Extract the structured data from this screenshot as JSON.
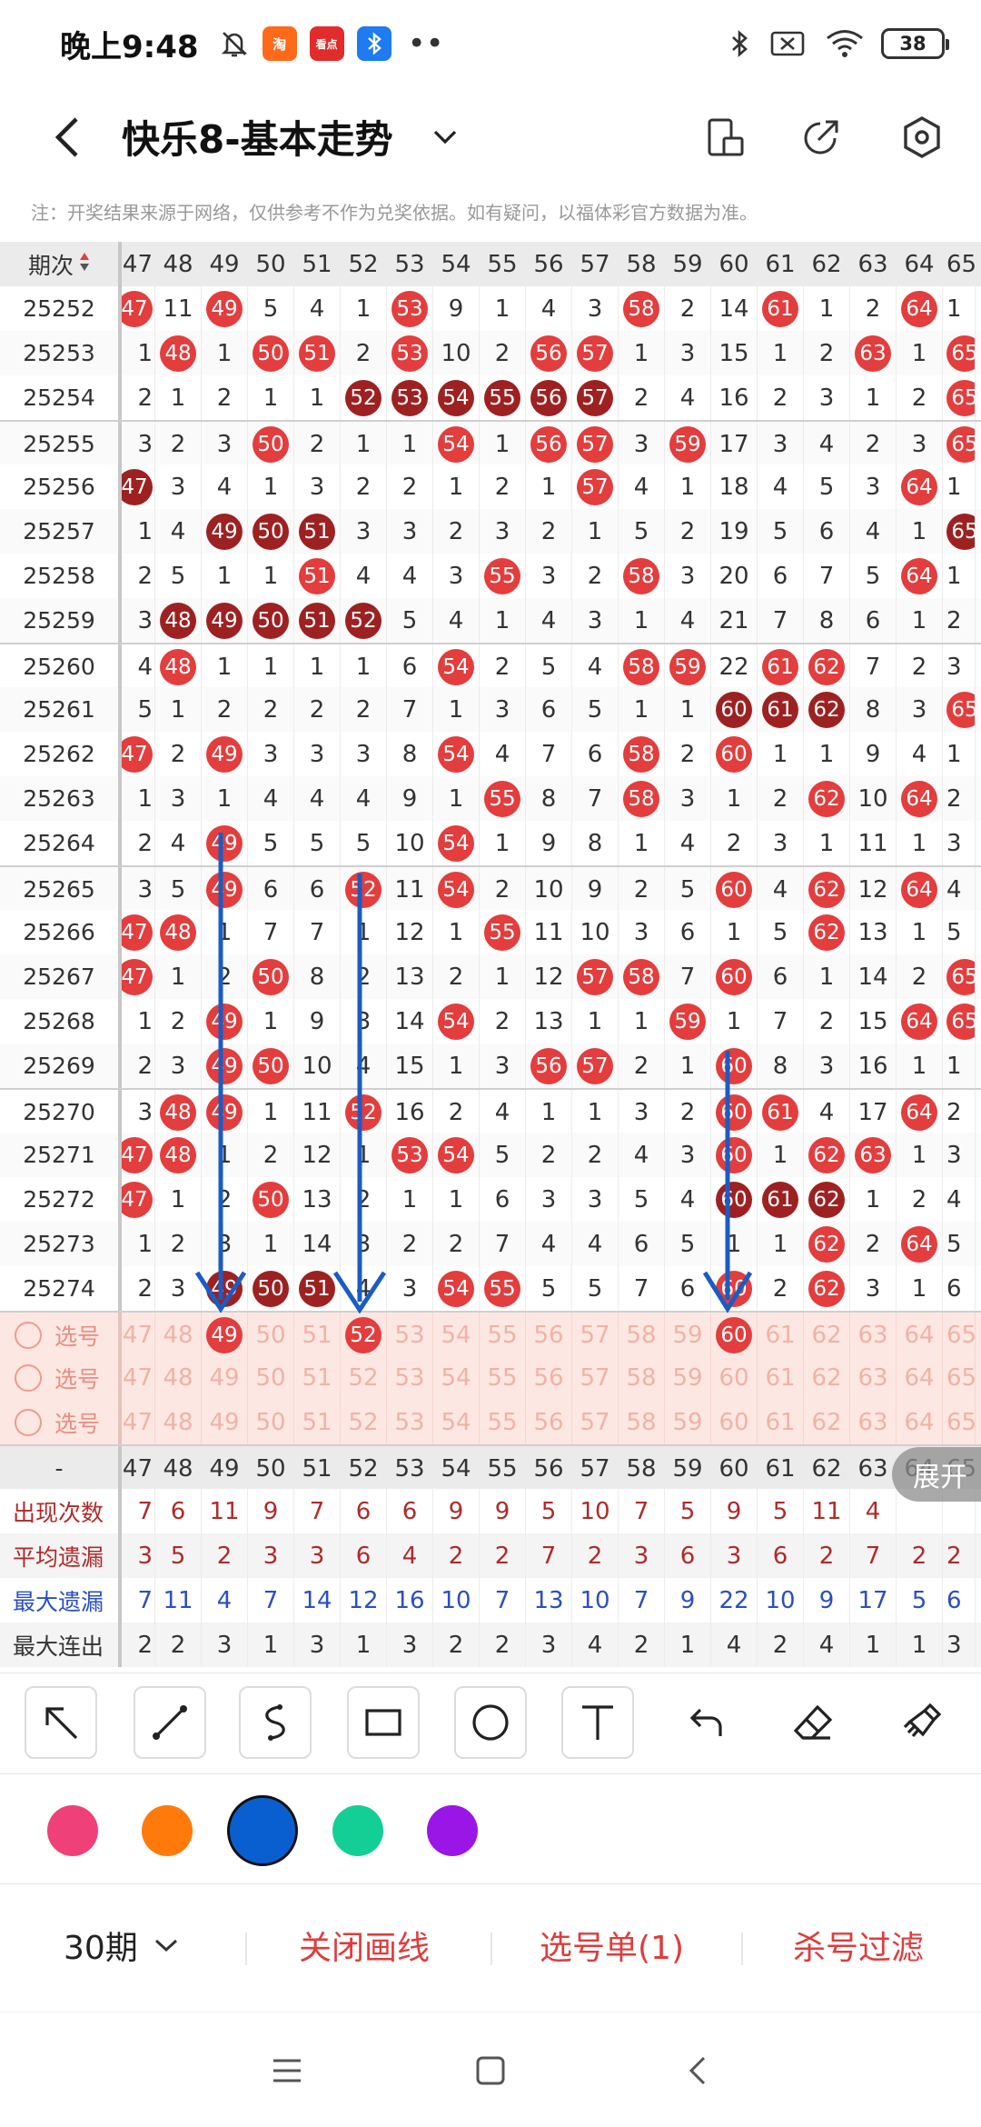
{
  "status_bar": {
    "time": "晚上9:48",
    "app1": "淘",
    "app2": "看点",
    "battery": "38"
  },
  "header": {
    "title": "快乐8-基本走势"
  },
  "notice": "注：开奖结果来源于网络，仅供参考不作为兑奖依据。如有疑问，以福体彩官方数据为准。",
  "table": {
    "period_header": "期次",
    "columns": [
      "47",
      "48",
      "49",
      "50",
      "51",
      "52",
      "53",
      "54",
      "55",
      "56",
      "57",
      "58",
      "59",
      "60",
      "61",
      "62",
      "63",
      "64",
      "65"
    ],
    "rows": [
      {
        "period": "25252",
        "cells": [
          "47",
          "11",
          "49",
          "5",
          "4",
          "1",
          "53",
          "9",
          "1",
          "4",
          "3",
          "58",
          "2",
          "14",
          "61",
          "1",
          "2",
          "64",
          "1"
        ],
        "hits": [
          0,
          2,
          6,
          11,
          14,
          17
        ],
        "dark": []
      },
      {
        "period": "25253",
        "cells": [
          "1",
          "48",
          "1",
          "50",
          "51",
          "2",
          "53",
          "10",
          "2",
          "56",
          "57",
          "1",
          "3",
          "15",
          "1",
          "2",
          "63",
          "1",
          "65"
        ],
        "hits": [
          1,
          3,
          4,
          6,
          9,
          10,
          16,
          18
        ],
        "dark": []
      },
      {
        "period": "25254",
        "cells": [
          "2",
          "1",
          "2",
          "1",
          "1",
          "52",
          "53",
          "54",
          "55",
          "56",
          "57",
          "2",
          "4",
          "16",
          "2",
          "3",
          "1",
          "2",
          "65"
        ],
        "hits": [
          5,
          6,
          7,
          8,
          9,
          10,
          18
        ],
        "dark": [
          5,
          6,
          7,
          8,
          9,
          10
        ]
      },
      {
        "period": "25255",
        "cells": [
          "3",
          "2",
          "3",
          "50",
          "2",
          "1",
          "1",
          "54",
          "1",
          "56",
          "57",
          "3",
          "59",
          "17",
          "3",
          "4",
          "2",
          "3",
          "65"
        ],
        "hits": [
          3,
          7,
          9,
          10,
          12,
          18
        ],
        "dark": []
      },
      {
        "period": "25256",
        "cells": [
          "47",
          "3",
          "4",
          "1",
          "3",
          "2",
          "2",
          "1",
          "2",
          "1",
          "57",
          "4",
          "1",
          "18",
          "4",
          "5",
          "3",
          "64",
          "1"
        ],
        "hits": [
          0,
          10,
          17
        ],
        "dark": [
          0
        ]
      },
      {
        "period": "25257",
        "cells": [
          "1",
          "4",
          "49",
          "50",
          "51",
          "3",
          "3",
          "2",
          "3",
          "2",
          "1",
          "5",
          "2",
          "19",
          "5",
          "6",
          "4",
          "1",
          "65"
        ],
        "hits": [
          2,
          3,
          4,
          18
        ],
        "dark": [
          2,
          3,
          4,
          18
        ]
      },
      {
        "period": "25258",
        "cells": [
          "2",
          "5",
          "1",
          "1",
          "51",
          "4",
          "4",
          "3",
          "55",
          "3",
          "2",
          "58",
          "3",
          "20",
          "6",
          "7",
          "5",
          "64",
          "1"
        ],
        "hits": [
          4,
          8,
          11,
          17
        ],
        "dark": []
      },
      {
        "period": "25259",
        "cells": [
          "3",
          "48",
          "49",
          "50",
          "51",
          "52",
          "5",
          "4",
          "1",
          "4",
          "3",
          "1",
          "4",
          "21",
          "7",
          "8",
          "6",
          "1",
          "2"
        ],
        "hits": [
          1,
          2,
          3,
          4,
          5
        ],
        "dark": [
          1,
          2,
          3,
          4,
          5
        ]
      },
      {
        "period": "25260",
        "cells": [
          "4",
          "48",
          "1",
          "1",
          "1",
          "1",
          "6",
          "54",
          "2",
          "5",
          "4",
          "58",
          "59",
          "22",
          "61",
          "62",
          "7",
          "2",
          "3"
        ],
        "hits": [
          1,
          7,
          11,
          12,
          14,
          15
        ],
        "dark": []
      },
      {
        "period": "25261",
        "cells": [
          "5",
          "1",
          "2",
          "2",
          "2",
          "2",
          "7",
          "1",
          "3",
          "6",
          "5",
          "1",
          "1",
          "60",
          "61",
          "62",
          "8",
          "3",
          "65"
        ],
        "hits": [
          13,
          14,
          15,
          18
        ],
        "dark": [
          13,
          14,
          15
        ]
      },
      {
        "period": "25262",
        "cells": [
          "47",
          "2",
          "49",
          "3",
          "3",
          "3",
          "8",
          "54",
          "4",
          "7",
          "6",
          "58",
          "2",
          "60",
          "1",
          "1",
          "9",
          "4",
          "1"
        ],
        "hits": [
          0,
          2,
          7,
          11,
          13
        ],
        "dark": []
      },
      {
        "period": "25263",
        "cells": [
          "1",
          "3",
          "1",
          "4",
          "4",
          "4",
          "9",
          "1",
          "55",
          "8",
          "7",
          "58",
          "3",
          "1",
          "2",
          "62",
          "10",
          "64",
          "2"
        ],
        "hits": [
          8,
          11,
          15,
          17
        ],
        "dark": []
      },
      {
        "period": "25264",
        "cells": [
          "2",
          "4",
          "49",
          "5",
          "5",
          "5",
          "10",
          "54",
          "1",
          "9",
          "8",
          "1",
          "4",
          "2",
          "3",
          "1",
          "11",
          "1",
          "3"
        ],
        "hits": [
          2,
          7
        ],
        "dark": []
      },
      {
        "period": "25265",
        "cells": [
          "3",
          "5",
          "49",
          "6",
          "6",
          "52",
          "11",
          "54",
          "2",
          "10",
          "9",
          "2",
          "5",
          "60",
          "4",
          "62",
          "12",
          "64",
          "4"
        ],
        "hits": [
          2,
          5,
          7,
          13,
          15,
          17
        ],
        "dark": []
      },
      {
        "period": "25266",
        "cells": [
          "47",
          "48",
          "1",
          "7",
          "7",
          "1",
          "12",
          "1",
          "55",
          "11",
          "10",
          "3",
          "6",
          "1",
          "5",
          "62",
          "13",
          "1",
          "5"
        ],
        "hits": [
          0,
          1,
          8,
          15
        ],
        "dark": []
      },
      {
        "period": "25267",
        "cells": [
          "47",
          "1",
          "2",
          "50",
          "8",
          "2",
          "13",
          "2",
          "1",
          "12",
          "57",
          "58",
          "7",
          "60",
          "6",
          "1",
          "14",
          "2",
          "65"
        ],
        "hits": [
          0,
          3,
          10,
          11,
          13,
          18
        ],
        "dark": []
      },
      {
        "period": "25268",
        "cells": [
          "1",
          "2",
          "49",
          "1",
          "9",
          "3",
          "14",
          "54",
          "2",
          "13",
          "1",
          "1",
          "59",
          "1",
          "7",
          "2",
          "15",
          "64",
          "65"
        ],
        "hits": [
          2,
          7,
          12,
          17,
          18
        ],
        "dark": []
      },
      {
        "period": "25269",
        "cells": [
          "2",
          "3",
          "49",
          "50",
          "10",
          "4",
          "15",
          "1",
          "3",
          "56",
          "57",
          "2",
          "1",
          "60",
          "8",
          "3",
          "16",
          "1",
          "1"
        ],
        "hits": [
          2,
          3,
          9,
          10,
          13
        ],
        "dark": []
      },
      {
        "period": "25270",
        "cells": [
          "3",
          "48",
          "49",
          "1",
          "11",
          "52",
          "16",
          "2",
          "4",
          "1",
          "1",
          "3",
          "2",
          "60",
          "61",
          "4",
          "17",
          "64",
          "2"
        ],
        "hits": [
          1,
          2,
          5,
          13,
          14,
          17
        ],
        "dark": []
      },
      {
        "period": "25271",
        "cells": [
          "47",
          "48",
          "1",
          "2",
          "12",
          "1",
          "53",
          "54",
          "5",
          "2",
          "2",
          "4",
          "3",
          "60",
          "1",
          "62",
          "63",
          "1",
          "3"
        ],
        "hits": [
          0,
          1,
          6,
          7,
          13,
          15,
          16
        ],
        "dark": []
      },
      {
        "period": "25272",
        "cells": [
          "47",
          "1",
          "2",
          "50",
          "13",
          "2",
          "1",
          "1",
          "6",
          "3",
          "3",
          "5",
          "4",
          "60",
          "61",
          "62",
          "1",
          "2",
          "4"
        ],
        "hits": [
          0,
          3,
          13,
          14,
          15
        ],
        "dark": [
          13,
          14,
          15
        ]
      },
      {
        "period": "25273",
        "cells": [
          "1",
          "2",
          "3",
          "1",
          "14",
          "3",
          "2",
          "2",
          "7",
          "4",
          "4",
          "6",
          "5",
          "1",
          "1",
          "62",
          "2",
          "64",
          "5"
        ],
        "hits": [
          15,
          17
        ],
        "dark": []
      },
      {
        "period": "25274",
        "cells": [
          "2",
          "3",
          "49",
          "50",
          "51",
          "4",
          "3",
          "54",
          "55",
          "5",
          "5",
          "7",
          "6",
          "60",
          "2",
          "62",
          "3",
          "1",
          "6"
        ],
        "hits": [
          2,
          3,
          4,
          7,
          8,
          13,
          15
        ],
        "dark": [
          2,
          3,
          4
        ]
      }
    ],
    "select_label": "选号",
    "select_rows": [
      {
        "hits": [
          2,
          5,
          13
        ]
      },
      {
        "hits": []
      },
      {
        "hits": []
      }
    ],
    "stats_header": "-",
    "stats": [
      {
        "label": "出现次数",
        "style": "stat-red",
        "cells": [
          "7",
          "6",
          "11",
          "9",
          "7",
          "6",
          "6",
          "9",
          "9",
          "5",
          "10",
          "7",
          "5",
          "9",
          "5",
          "11",
          "4",
          "",
          ""
        ]
      },
      {
        "label": "平均遗漏",
        "style": "stat-red",
        "cells": [
          "3",
          "5",
          "2",
          "3",
          "3",
          "6",
          "4",
          "2",
          "2",
          "7",
          "2",
          "3",
          "6",
          "3",
          "6",
          "2",
          "7",
          "2",
          "2"
        ]
      },
      {
        "label": "最大遗漏",
        "style": "stat-blue",
        "cells": [
          "7",
          "11",
          "4",
          "7",
          "14",
          "12",
          "16",
          "10",
          "7",
          "13",
          "10",
          "7",
          "9",
          "22",
          "10",
          "9",
          "17",
          "5",
          "6"
        ]
      },
      {
        "label": "最大连出",
        "style": "stat-dark",
        "cells": [
          "2",
          "2",
          "3",
          "1",
          "3",
          "1",
          "3",
          "2",
          "2",
          "3",
          "4",
          "2",
          "1",
          "4",
          "2",
          "4",
          "1",
          "1",
          "3"
        ]
      }
    ],
    "expand_label": "展开"
  },
  "draw_tools": [
    "arrow-tool",
    "line-tool",
    "curve-tool",
    "rect-tool",
    "circle-tool",
    "text-tool",
    "undo-tool",
    "eraser-tool",
    "clear-tool"
  ],
  "colors": [
    "#f0407a",
    "#ff7a0a",
    "#0a5fd0",
    "#13cf96",
    "#9a16e6"
  ],
  "bottom_bar": {
    "period": "30期",
    "close_draw": "关闭画线",
    "selection": "选号单(1)",
    "filter": "杀号过滤"
  }
}
